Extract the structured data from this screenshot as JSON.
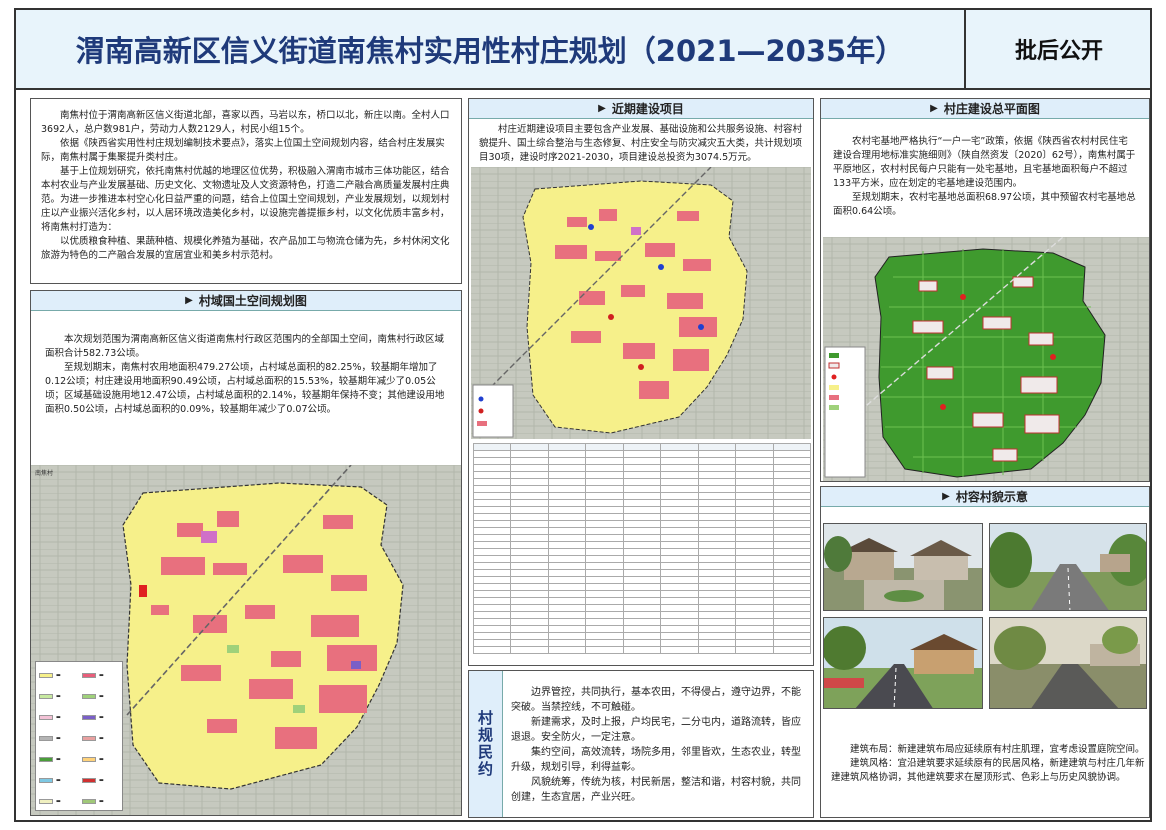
{
  "title": {
    "main": "渭南高新区信义街道南焦村实用性村庄规划（2021—2035年）",
    "stamp": "批后公开"
  },
  "intro": {
    "paragraphs": [
      "南焦村位于渭南高新区信义街道北部，喜家以西，马岩以东，桥口以北，新庄以南。全村人口3692人，总户数981户，劳动力人数2129人，村民小组15个。",
      "依据《陕西省实用性村庄规划编制技术要点》，落实上位国土空间规划内容，结合村庄发展实际，南焦村属于集聚提升类村庄。",
      "基于上位规划研究，依托南焦村优越的地理区位优势，积极融入渭南市城市三体功能区，结合本村农业与产业发展基础、历史文化、文物遗址及人文资源特色，打造二产融合高质量发展村庄典范。为进一步推进本村空心化日益严重的问题，结合上位国土空间规划，产业发展规划，以规划村庄以产业振兴活化乡村，以人居环境改造美化乡村，以设施完善提振乡村，以文化优质丰富乡村，将南焦村打造为：",
      "以优质粮食种植、果蔬种植、规模化养殖为基础，农产品加工与物流仓储为先，乡村休闲文化旅游为特色的二产融合发展的宜居宜业和美乡村示范村。"
    ]
  },
  "territory": {
    "heading": "村域国土空间规划图",
    "paragraphs": [
      "本次规划范围为渭南高新区信义街道南焦村行政区范围内的全部国土空间，南焦村行政区域面积合计582.73公顷。",
      "至规划期末，南焦村农用地面积479.27公顷，占村域总面积的82.25%，较基期年增加了0.12公顷；村庄建设用地面积90.49公顷，占村域总面积的15.53%，较基期年减少了0.05公顷；区域基础设施用地12.47公顷，占村域总面积的2.14%，较基期年保持不变；其他建设用地面积0.50公顷，占村域总面积的0.09%，较基期年减少了0.07公顷。"
    ],
    "map_north_label": "南焦村"
  },
  "projects": {
    "heading": "近期建设项目",
    "paragraph": "村庄近期建设项目主要包含产业发展、基础设施和公共服务设施、村容村貌提升、国土综合整治与生态修复、村庄安全与防灾减灾五大类，共计规划项目30项，建设时序2021-2030，项目建设总投资为3074.5万元。"
  },
  "village_rules": {
    "side_label": "村规民约",
    "paragraphs": [
      "边界管控，共同执行，基本农田，不得侵占，遵守边界，不能突破。当禁控线，不可触碰。",
      "新建需求，及时上报，户均民宅，二分屯内，道路流转，皆应退退。安全防火，一定注意。",
      "集约空间，高效流转，场院多用，邻里皆欢，生态农业，转型升级，规划引导，利得益彰。",
      "风貌统筹，传统为核，村民新居，整洁和谐，村容村貌，共同创建，生态宜居，产业兴旺。"
    ]
  },
  "construction": {
    "heading": "村庄建设总平面图",
    "paragraphs": [
      "农村宅基地严格执行“一户一宅”政策，依据《陕西省农村村民住宅建设合理用地标准实施细则》（陕自然资发〔2020〕62号），南焦村属于平原地区，农村村民每户只能有一处宅基地，且宅基地面积每户不超过133平方米，应在划定的宅基地建设范围内。",
      "至规划期末，农村宅基地总面积68.97公顷，其中预留农村宅基地总面积0.64公顷。"
    ]
  },
  "appearance": {
    "heading": "村容村貌示意",
    "paragraphs": [
      "建筑布局：新建建筑布局应延续原有村庄肌理，宜考虑设置庭院空间。",
      "建筑风格：宜沿建筑要求延续原有的民居风格，新建建筑与村庄几年新建建筑风格协调，其他建筑要求在屋顶形式、色彩上与历史风貌协调。"
    ]
  },
  "legend_colors": [
    "#f6f08a",
    "#e85d7a",
    "#c7e9a0",
    "#9fd17a",
    "#f3c2d6",
    "#7a5fc7",
    "#b4b4b4",
    "#e8a0a0",
    "#4a9d3a",
    "#ffd27a",
    "#7ec8e3",
    "#d03030",
    "#f0f0c0",
    "#a0c878",
    "#c080c0",
    "#707070"
  ],
  "colors": {
    "title_text": "#1f3a7a",
    "panel_head": "#dfeefa",
    "build_land": "#f6f08a",
    "residential": "#e8707e",
    "farmland": "#3f9a2e"
  }
}
